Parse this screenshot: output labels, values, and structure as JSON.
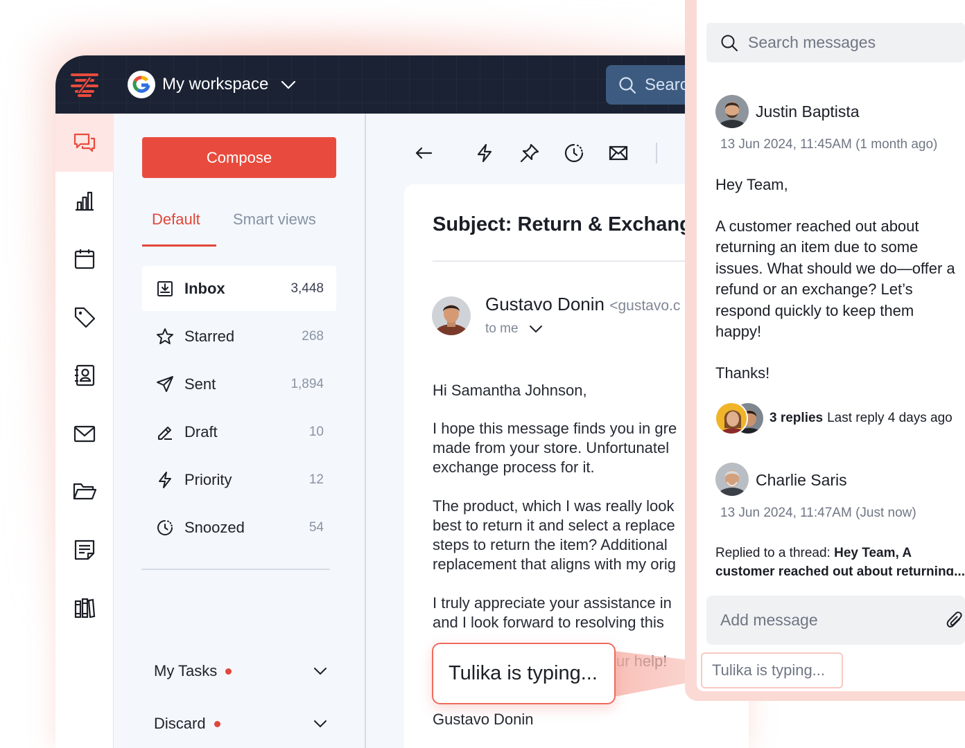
{
  "colors": {
    "brand": "#e84b3d",
    "topbar": "#1a2233",
    "panel_bg": "#f4f7fc",
    "typing_border": "#ee6b5e"
  },
  "topbar": {
    "logo_icon": "brand-logo-icon",
    "workspace_name": "My workspace",
    "search_placeholder": "Searc"
  },
  "rail": {
    "items": [
      {
        "icon": "chat-icon",
        "active": true
      },
      {
        "icon": "bar-chart-icon"
      },
      {
        "icon": "calendar-icon"
      },
      {
        "icon": "tag-icon"
      },
      {
        "icon": "contacts-icon"
      },
      {
        "icon": "mail-icon"
      },
      {
        "icon": "folder-icon"
      },
      {
        "icon": "notes-icon"
      },
      {
        "icon": "books-icon"
      }
    ]
  },
  "folders": {
    "compose_label": "Compose",
    "tabs": [
      {
        "label": "Default",
        "active": true
      },
      {
        "label": "Smart views"
      }
    ],
    "items": [
      {
        "label": "Inbox",
        "count": "3,448",
        "icon": "inbox-icon",
        "selected": true
      },
      {
        "label": "Starred",
        "count": "268",
        "icon": "star-icon"
      },
      {
        "label": "Sent",
        "count": "1,894",
        "icon": "send-icon"
      },
      {
        "label": "Draft",
        "count": "10",
        "icon": "pencil-icon"
      },
      {
        "label": "Priority",
        "count": "12",
        "icon": "lightning-icon"
      },
      {
        "label": "Snoozed",
        "count": "54",
        "icon": "snooze-icon"
      }
    ],
    "sections": [
      {
        "label": "My Tasks"
      },
      {
        "label": "Discard"
      }
    ]
  },
  "mail": {
    "toolbar": [
      "back-arrow-icon",
      "lightning-icon",
      "pin-icon",
      "snooze-icon",
      "envelope-icon"
    ],
    "subject": "Subject: Return & Exchange",
    "sender_name": "Gustavo Donin",
    "sender_email": "<gustavo.c",
    "recipient": "to me",
    "body": [
      "Hi Samantha Johnson,",
      "I hope this message finds you in gre",
      "made from your store. Unfortunatel",
      "exchange process for it.",
      "The product, which I was really look",
      "best to return it and select a replace",
      "steps to return the item? Additional",
      "replacement that aligns with my orig",
      "I truly appreciate your assistance in",
      "and I look forward to resolving this",
      "ur help!"
    ],
    "sign_off": "Gustavo Donin"
  },
  "typing": {
    "bubble": "Tulika is typing...",
    "chip": "Tulika is typing..."
  },
  "chat": {
    "search_placeholder": "Search messages",
    "message1": {
      "author": "Justin Baptista",
      "time": "13 Jun 2024, 11:45AM (1 month ago)",
      "greeting": "Hey Team,",
      "lines": [
        "A customer reached out about",
        "returning an item due to some",
        "issues. What should we do—offer a",
        "refund or an exchange? Let’s",
        "respond quickly to keep them",
        "happy!"
      ],
      "closing": "Thanks!"
    },
    "replies": {
      "count": "3 replies",
      "last": "Last reply 4 days ago"
    },
    "message2": {
      "author": "Charlie Saris",
      "time": "13 Jun 2024, 11:47AM (Just now)",
      "prefix": "Replied to a thread: ",
      "quote": "Hey Team, A customer reached out about returning..."
    },
    "compose_placeholder": "Add message"
  }
}
